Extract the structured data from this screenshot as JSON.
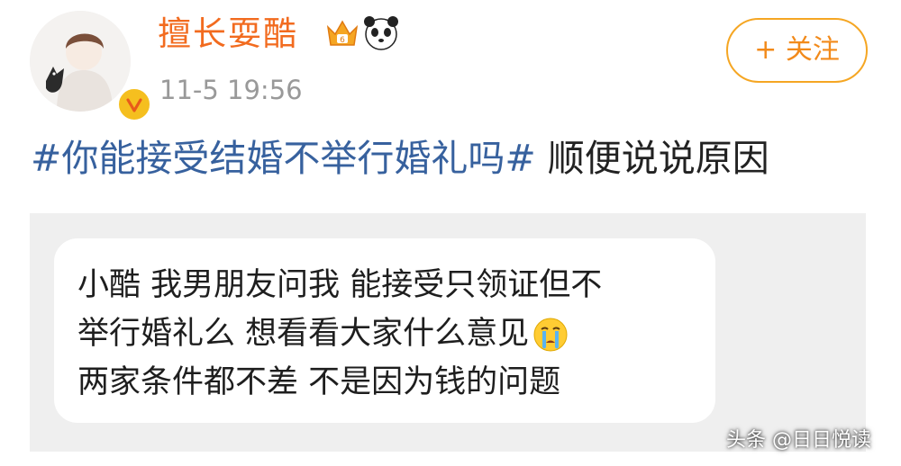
{
  "colors": {
    "username": "#f26b1f",
    "timestamp": "#999999",
    "hashtag": "#37619e",
    "follow_border": "#f5a623",
    "quote_background": "#efefef"
  },
  "post": {
    "username": "擅长耍酷",
    "timestamp": "11-5 19:56",
    "follow_label": "+ 关注",
    "hashtag": "#你能接受结婚不举行婚礼吗#",
    "text_after_hashtag": " 顺便说说原因",
    "badge_icons": [
      "crown-badge-icon",
      "panda-icon"
    ],
    "verified_icon": "verified-badge-icon"
  },
  "quoted_message": {
    "lines": [
      "小酷 我男朋友问我 能接受只领证但不",
      "举行婚礼么 想看看大家什么意见",
      "两家条件都不差 不是因为钱的问题"
    ],
    "emoji": "crying-face-icon"
  },
  "watermark": "头条 @日日悦读"
}
